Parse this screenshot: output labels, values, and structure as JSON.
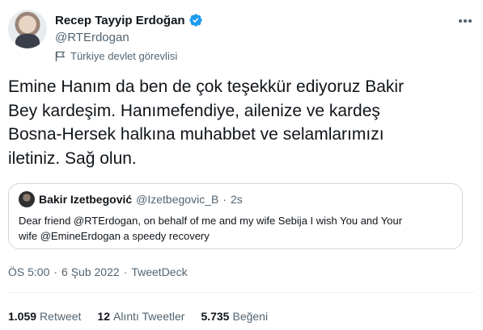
{
  "author": {
    "display_name": "Recep Tayyip Erdoğan",
    "handle": "@RTErdogan",
    "label": "Türkiye devlet görevlisi",
    "verified_color": "#1d9bf0"
  },
  "tweet": {
    "text": "Emine Hanım da ben de çok teşekkür ediyoruz Bakir\nBey kardeşim. Hanımefendiye, ailenize ve kardeş\nBosna-Hersek halkına muhabbet ve selamlarımızı\niletiniz. Sağ olun."
  },
  "quote": {
    "display_name": "Bakir Izetbegović",
    "handle": "@Izetbegovic_B",
    "separator": "·",
    "time": "2s",
    "text": "Dear friend @RTErdogan, on behalf of me and my wife Sebija I wish You and Your\nwife @EmineErdogan a speedy recovery"
  },
  "meta": {
    "time": "ÖS 5:00",
    "separator1": "·",
    "date": "6 Şub 2022",
    "separator2": "·",
    "source": "TweetDeck"
  },
  "stats": {
    "retweets_count": "1.059",
    "retweets_label": "Retweet",
    "quotes_count": "12",
    "quotes_label": "Alıntı Tweetler",
    "likes_count": "5.735",
    "likes_label": "Beğeni"
  },
  "icons": {
    "more": "more-icon",
    "verified": "verified-badge-icon",
    "flag": "flag-icon"
  }
}
